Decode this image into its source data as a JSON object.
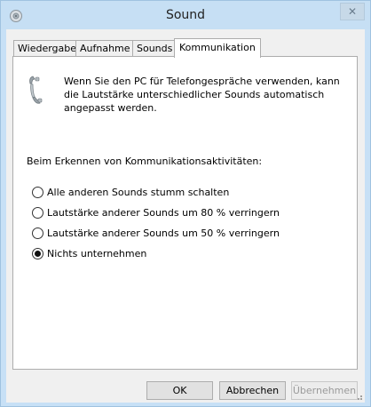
{
  "window": {
    "title": "Sound",
    "close_glyph": "✕"
  },
  "tabs": [
    {
      "label": "Wiedergabe",
      "active": false
    },
    {
      "label": "Aufnahme",
      "active": false
    },
    {
      "label": "Sounds",
      "active": false
    },
    {
      "label": "Kommunikation",
      "active": true
    }
  ],
  "panel": {
    "icon": "telephone-handset-icon",
    "info_text": "Wenn Sie den PC für Telefongespräche verwenden, kann die Lautstärke unterschiedlicher Sounds automatisch angepasst werden.",
    "section_label": "Beim Erkennen von Kommunikationsaktivitäten:",
    "options": [
      {
        "label": "Alle anderen Sounds stumm schalten",
        "checked": false
      },
      {
        "label": "Lautstärke anderer Sounds um 80 % verringern",
        "checked": false
      },
      {
        "label": "Lautstärke anderer Sounds um 50 % verringern",
        "checked": false
      },
      {
        "label": "Nichts unternehmen",
        "checked": true
      }
    ]
  },
  "buttons": {
    "ok": "OK",
    "cancel": "Abbrechen",
    "apply": "Übernehmen"
  }
}
